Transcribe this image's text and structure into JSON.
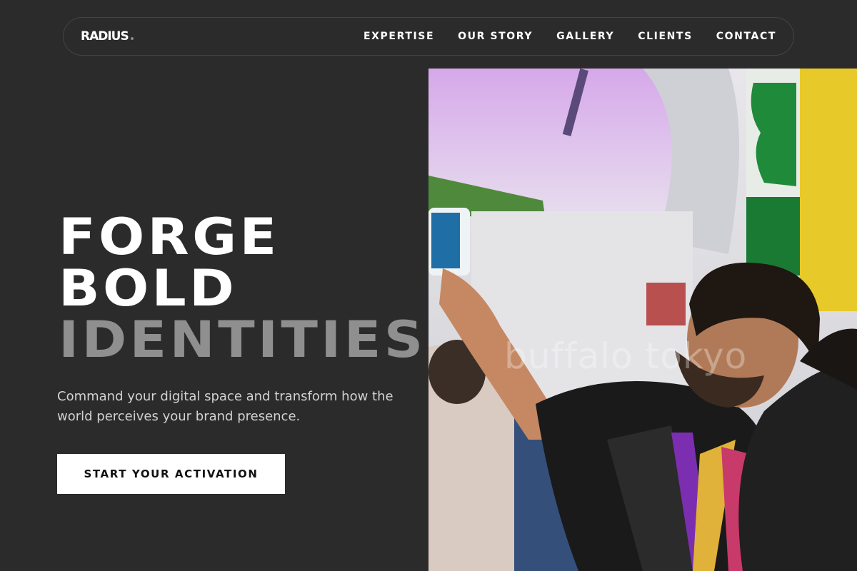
{
  "brand": {
    "name": "RADIUS"
  },
  "nav": {
    "items": [
      {
        "label": "EXPERTISE"
      },
      {
        "label": "OUR STORY"
      },
      {
        "label": "GALLERY"
      },
      {
        "label": "CLIENTS"
      },
      {
        "label": "CONTACT"
      }
    ]
  },
  "hero": {
    "headline": [
      "FORGE",
      "BOLD",
      "IDENTITIES"
    ],
    "subtitle": "Command your digital space and transform how the world perceives your brand presence.",
    "cta_label": "START YOUR ACTIVATION",
    "photo_watermark": "buffalo tokyo"
  },
  "colors": {
    "background": "#2b2b2b",
    "text": "#ffffff",
    "accent_grey": "#8f8f8f",
    "cta_bg": "#ffffff"
  }
}
